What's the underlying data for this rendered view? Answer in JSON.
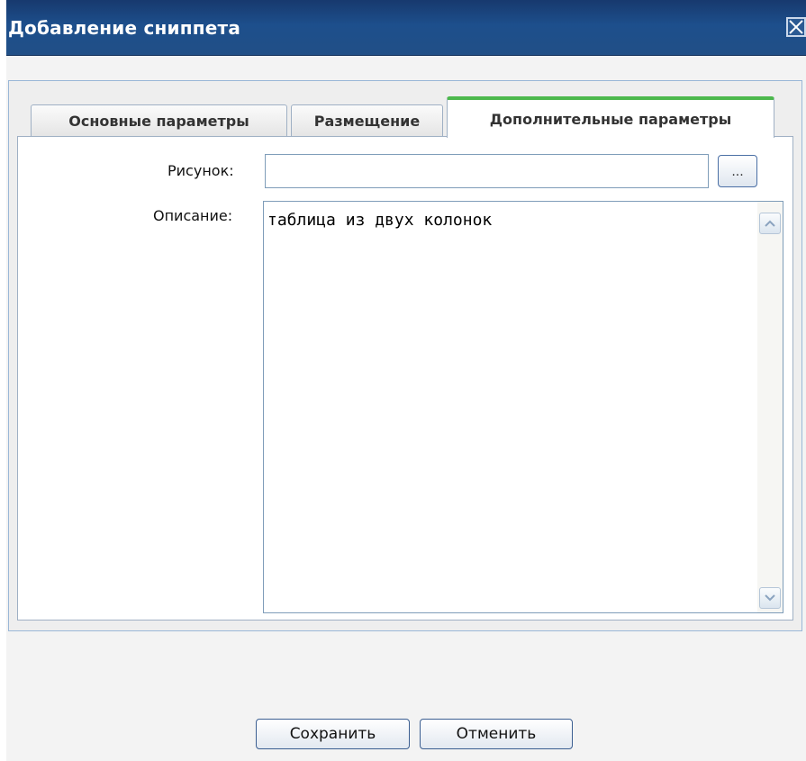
{
  "dialog": {
    "title": "Добавление сниппета",
    "close_icon": "close-icon"
  },
  "tabs": [
    {
      "label": "Основные параметры",
      "active": false
    },
    {
      "label": "Размещение",
      "active": false
    },
    {
      "label": "Дополнительные параметры",
      "active": true
    }
  ],
  "form": {
    "image": {
      "label": "Рисунок:",
      "value": "",
      "browse_label": "..."
    },
    "description": {
      "label": "Описание:",
      "value": "таблица из двух колонок"
    }
  },
  "scrollbar_icons": {
    "up": "scroll-up-icon",
    "down": "scroll-down-icon"
  },
  "buttons": {
    "save": "Сохранить",
    "cancel": "Отменить"
  },
  "colors": {
    "titlebar": "#1d4f8c",
    "active_tab_accent": "#4cb84c",
    "panel_border": "#9ab7d7"
  }
}
